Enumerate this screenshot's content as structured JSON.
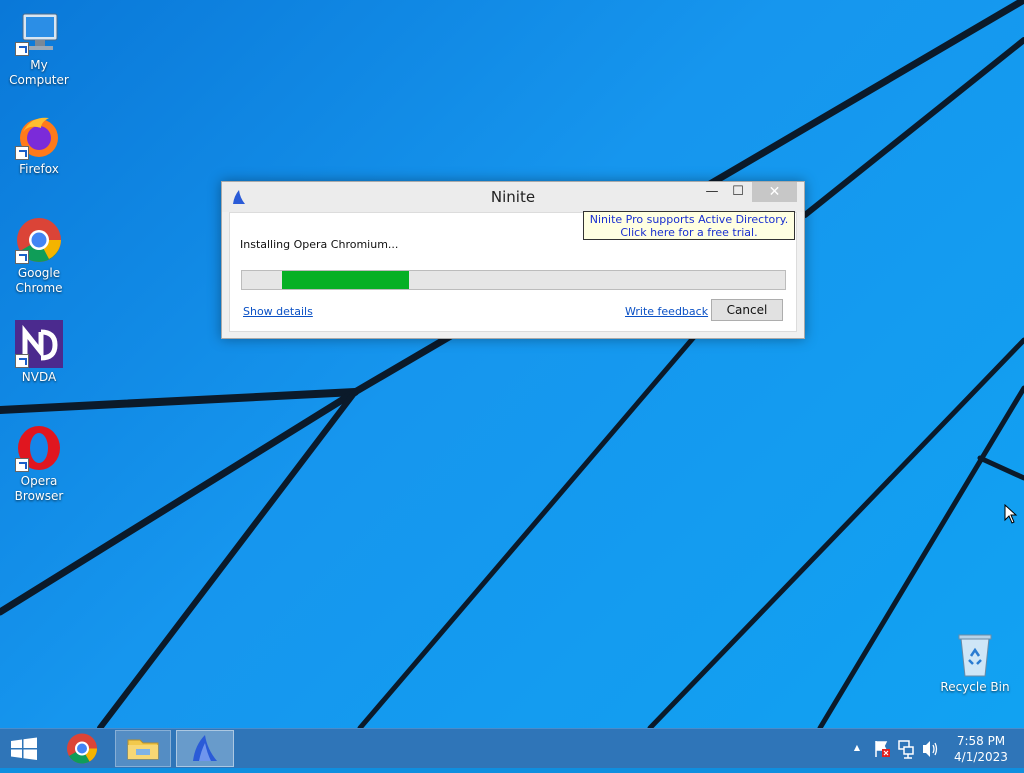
{
  "desktop": {
    "icons": [
      {
        "label": "My Computer",
        "icon": "computer-icon"
      },
      {
        "label": "Firefox",
        "icon": "firefox-icon"
      },
      {
        "label": "Google Chrome",
        "icon": "chrome-icon"
      },
      {
        "label": "NVDA",
        "icon": "nvda-icon"
      },
      {
        "label": "Opera Browser",
        "icon": "opera-icon"
      },
      {
        "label": "Recycle Bin",
        "icon": "recycle-bin-icon"
      }
    ]
  },
  "window": {
    "title": "Ninite",
    "minimize_glyph": "—",
    "maximize_glyph": "☐",
    "close_glyph": "✕",
    "promo_line1": "Ninite Pro supports Active Directory.",
    "promo_line2": "Click here for a free trial.",
    "status_text": "Installing Opera Chromium...",
    "progress": {
      "start_fraction": 0.074,
      "end_fraction": 0.307,
      "color": "#06b025"
    },
    "show_details": "Show details",
    "write_feedback": "Write feedback",
    "cancel": "Cancel"
  },
  "taskbar": {
    "items": [
      "start-button",
      "chrome-icon",
      "file-explorer-icon",
      "ninite-icon"
    ],
    "tray": {
      "show_hidden": "▲",
      "time": "7:58 PM",
      "date": "4/1/2023"
    }
  },
  "colors": {
    "taskbar": "#2f75b8",
    "desktop": "#1696ee",
    "link": "#0b51c5"
  }
}
